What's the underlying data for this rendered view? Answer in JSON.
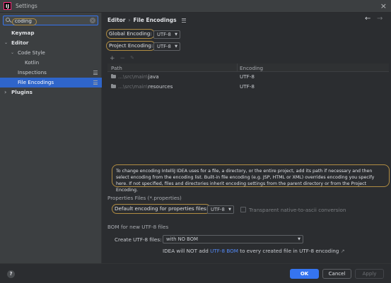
{
  "window": {
    "title": "Settings",
    "close_glyph": "×"
  },
  "sidebar": {
    "search": {
      "value": "coding",
      "clear_glyph": "×"
    },
    "items": [
      {
        "label": "Keymap"
      },
      {
        "label": "Editor",
        "arrow": "⌄"
      },
      {
        "label": "Code Style",
        "arrow": "⌄"
      },
      {
        "label": "Kotlin"
      },
      {
        "label": "Inspections"
      },
      {
        "label": "File Encodings"
      },
      {
        "label": "Plugins",
        "arrow": "›"
      }
    ]
  },
  "main": {
    "breadcrumb": {
      "parent": "Editor",
      "separator": "›",
      "current": "File Encodings"
    },
    "nav": {
      "back": "←",
      "forward": "→"
    },
    "global_encoding": {
      "label": "Global Encoding:",
      "value": "UTF-8"
    },
    "project_encoding": {
      "label": "Project Encoding:",
      "value": "UTF-8"
    },
    "toolbar": {
      "add": "+",
      "remove": "−",
      "edit": "✎"
    },
    "table": {
      "columns": [
        "Path",
        "Encoding"
      ],
      "rows": [
        {
          "path_prefix": "...\\src\\main\\",
          "path_name": "java",
          "encoding": "UTF-8"
        },
        {
          "path_prefix": "...\\src\\main\\",
          "path_name": "resources",
          "encoding": "UTF-8"
        }
      ]
    },
    "note": "To change encoding IntelliJ IDEA uses for a file, a directory, or the entire project, add its path if necessary and then select encoding from the encoding list. Built-in file encoding (e.g. JSP, HTML or XML) overrides encoding you specify here. If not specified, files and directories inherit encoding settings from the parent directory or from the Project Encoding.",
    "properties": {
      "title": "Properties Files (*.properties)",
      "default_label": "Default encoding for properties files:",
      "default_value": "UTF-8",
      "native_label": "Transparent native-to-ascii conversion",
      "native_checked": false
    },
    "bom": {
      "title": "BOM for new UTF-8 files",
      "create_label": "Create UTF-8 files:",
      "create_value": "with NO BOM",
      "info_prefix": "IDEA will NOT add",
      "info_link": "UTF-8 BOM",
      "info_suffix": "to every created file in UTF-8 encoding",
      "info_icon": "↗"
    }
  },
  "footer": {
    "help": "?",
    "ok": "OK",
    "cancel": "Cancel",
    "apply": "Apply"
  },
  "colors": {
    "accent": "#3574f0",
    "selection": "#2f65ca",
    "highlight_ring": "#b08c42",
    "link": "#548af7"
  }
}
